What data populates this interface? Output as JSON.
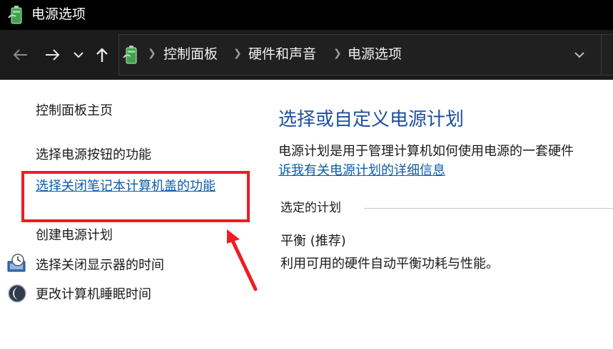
{
  "window": {
    "title": "电源选项"
  },
  "navbar": {
    "breadcrumb": [
      "控制面板",
      "硬件和声音",
      "电源选项"
    ]
  },
  "sidebar": {
    "home": "控制面板主页",
    "links": [
      "选择电源按钮的功能",
      "选择关闭笔记本计算机盖的功能",
      "创建电源计划",
      "选择关闭显示器的时间",
      "更改计算机睡眠时间"
    ]
  },
  "main": {
    "title": "选择或自定义电源计划",
    "description": "电源计划是用于管理计算机如何使用电源的一套硬件",
    "learn_more": "诉我有关电源计划的详细信息",
    "section_label": "选定的计划",
    "plan_name": "平衡 (推荐)",
    "plan_description": "利用可用的硬件自动平衡功耗与性能。"
  },
  "colors": {
    "title_blue": "#1d4fa0",
    "link_blue": "#0b5cad",
    "highlight_red": "#ee1c24"
  }
}
